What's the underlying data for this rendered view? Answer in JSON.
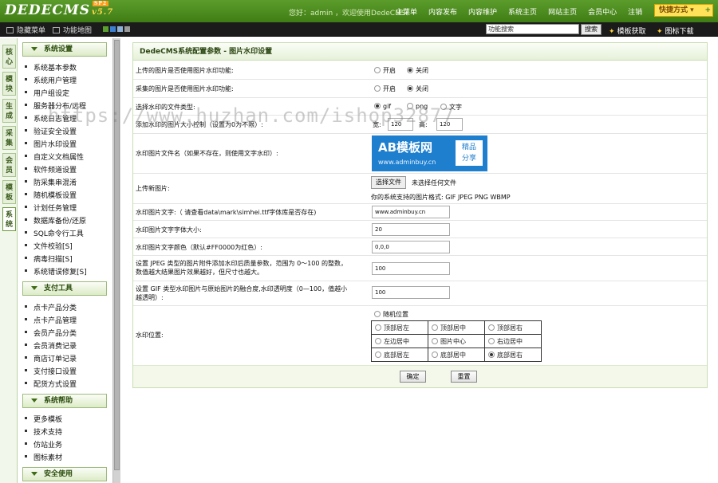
{
  "app": {
    "logo": "DEDECMS",
    "version": "v5.7",
    "version_badge": "SP2",
    "welcome": "您好：admin ，欢迎使用DedeCMS！",
    "topnav": [
      "主菜单",
      "内容发布",
      "内容维护",
      "系统主页",
      "网站主页",
      "会员中心",
      "注销"
    ],
    "quick_menu": "快捷方式"
  },
  "subbar": {
    "hide_menu": "隐藏菜单",
    "site_map": "功能地图",
    "search_value": "功能搜索",
    "search_btn": "搜索",
    "template_get": "模板获取",
    "icon_download": "图标下载"
  },
  "left_tabs": [
    {
      "label": "核心"
    },
    {
      "label": "模块"
    },
    {
      "label": "生成"
    },
    {
      "label": "采集"
    },
    {
      "label": "会员"
    },
    {
      "label": "模板"
    },
    {
      "label": "系统"
    }
  ],
  "sidebar": {
    "sections": [
      {
        "title": "系统设置",
        "items": [
          "系统基本参数",
          "系统用户管理",
          "用户组设定",
          "服务器分布/远程",
          "系统日志管理",
          "验证安全设置",
          "图片水印设置",
          "自定义文档属性",
          "软件频道设置",
          "防采集串混淆",
          "随机模板设置",
          "计划任务管理",
          "数据库备份/还原",
          "SQL命令行工具",
          "文件校验[S]",
          "病毒扫描[S]",
          "系统错误修复[S]"
        ]
      },
      {
        "title": "支付工具",
        "items": [
          "点卡产品分类",
          "点卡产品管理",
          "会员产品分类",
          "会员消费记录",
          "商店订单记录",
          "支付接口设置",
          "配货方式设置"
        ]
      },
      {
        "title": "系统帮助",
        "items": [
          "更多模板",
          "技术支持",
          "仿站业务",
          "图标素材"
        ]
      },
      {
        "title": "安全使用",
        "items": []
      }
    ]
  },
  "panel": {
    "title": "DedeCMS系统配置参数 - 图片水印设置",
    "rows": {
      "upload_label": "上传的图片是否使用图片水印功能:",
      "collect_label": "采集的图片是否使用图片水印功能:",
      "open": "开启",
      "close": "关闭",
      "type_label": "选择水印的文件类型:",
      "type_gif": "gif",
      "type_png": "png",
      "type_text": "文字",
      "size_label": "添加水印的图片大小控制（设置为0为不限）:",
      "width_label": "宽:",
      "width_value": "120",
      "height_label": "高:",
      "height_value": "120",
      "file_label": "水印图片文件名（如果不存在，则使用文字水印）:",
      "logo_big": "AB模板网",
      "logo_url": "www.adminbuy.cn",
      "logo_box1": "精品",
      "logo_box2": "分享",
      "upload_new_label": "上传新图片:",
      "choose_file": "选择文件",
      "no_file": "未选择任何文件",
      "formats": "你的系统支持的图片格式: GIF JPEG PNG WBMP",
      "text_label": "水印图片文字:（ 请查看data\\mark\\simhei.ttf字体库是否存在)",
      "text_value": "www.adminbuy.cn",
      "font_size_label": "水印图片文字字体大小:",
      "font_size_value": "20",
      "color_label": "水印图片文字颜色（默认#FF0000为红色）:",
      "color_value": "0,0,0",
      "jpeg_label1": "设置 JPEG 类型的图片附件添加水印后质量参数，范围为 0～100 的整数，",
      "jpeg_label2": "数值越大结果图片效果越好，但尺寸也越大。",
      "jpeg_value": "100",
      "gif_label1": "设置 GIF 类型水印图片与原始图片的融合度,水印透明度（0—100，值越小",
      "gif_label2": "越透明）:",
      "gif_value": "100",
      "pos_label": "水印位置:",
      "pos_random": "随机位置",
      "positions": [
        [
          "顶部居左",
          "顶部居中",
          "顶部居右"
        ],
        [
          "左边居中",
          "图片中心",
          "右边居中"
        ],
        [
          "底部居左",
          "底部居中",
          "底部居右"
        ]
      ]
    },
    "ok_btn": "确定",
    "reset_btn": "重置"
  },
  "watermark": "https://www.huzhan.com/ishop32877"
}
